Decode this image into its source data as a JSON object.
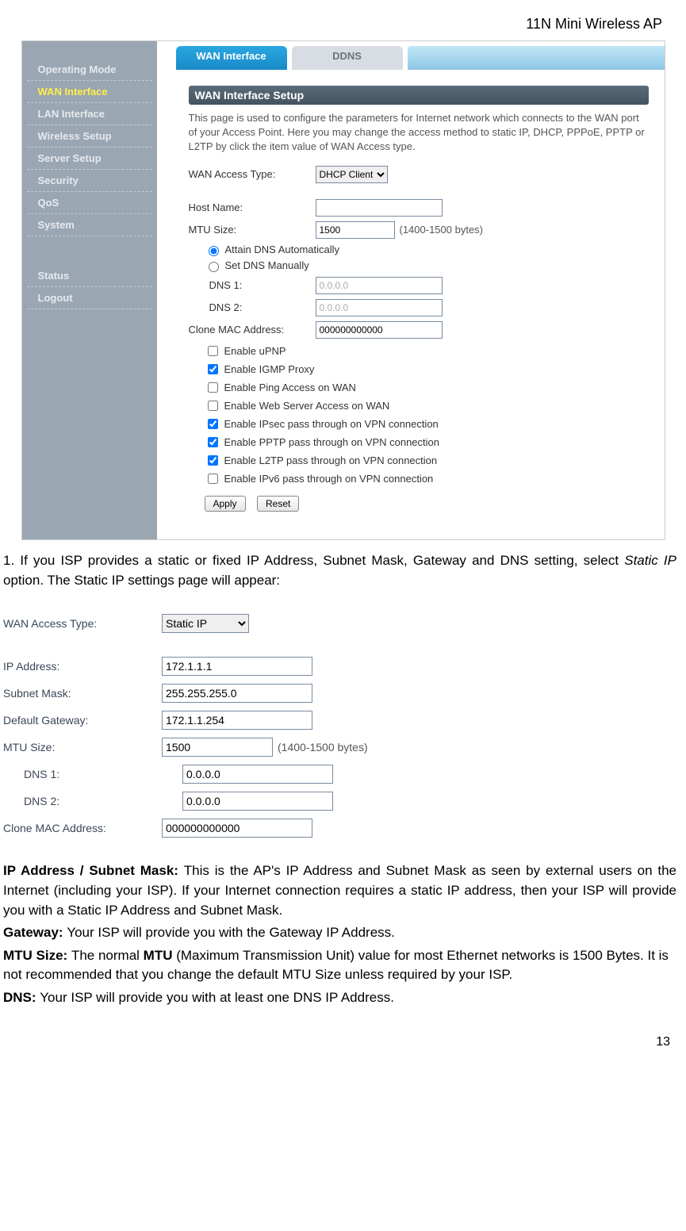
{
  "header": "11N Mini Wireless AP",
  "page_number": "13",
  "sidebar": {
    "items": [
      {
        "label": "Operating Mode",
        "active": false
      },
      {
        "label": "WAN Interface",
        "active": true
      },
      {
        "label": "LAN Interface",
        "active": false
      },
      {
        "label": "Wireless Setup",
        "active": false
      },
      {
        "label": "Server Setup",
        "active": false
      },
      {
        "label": "Security",
        "active": false
      },
      {
        "label": "QoS",
        "active": false
      },
      {
        "label": "System",
        "active": false
      }
    ],
    "lower": [
      {
        "label": "Status"
      },
      {
        "label": "Logout"
      }
    ]
  },
  "tabs": {
    "active": "WAN Interface",
    "inactive": "DDNS"
  },
  "panel": {
    "title": "WAN Interface Setup",
    "desc": "This page is used to configure the parameters for Internet network which connects to the WAN port of your Access Point. Here you may change the access method to static IP, DHCP, PPPoE, PPTP or L2TP by click the item value of WAN Access type.",
    "wan_access_label": "WAN Access Type:",
    "wan_access_value": "DHCP Client",
    "host_label": "Host Name:",
    "host_value": "",
    "mtu_label": "MTU Size:",
    "mtu_value": "1500",
    "mtu_hint": "(1400-1500 bytes)",
    "radio_auto": "Attain DNS Automatically",
    "radio_manual": "Set DNS Manually",
    "dns1_label": "DNS 1:",
    "dns1_value": "0.0.0.0",
    "dns2_label": "DNS 2:",
    "dns2_value": "0.0.0.0",
    "mac_label": "Clone MAC Address:",
    "mac_value": "000000000000",
    "checks": [
      {
        "label": "Enable uPNP",
        "checked": false
      },
      {
        "label": "Enable IGMP Proxy",
        "checked": true
      },
      {
        "label": "Enable Ping Access on WAN",
        "checked": false
      },
      {
        "label": "Enable Web Server Access on WAN",
        "checked": false
      },
      {
        "label": "Enable IPsec pass through on VPN connection",
        "checked": true
      },
      {
        "label": "Enable PPTP pass through on VPN connection",
        "checked": true
      },
      {
        "label": "Enable L2TP pass through on VPN connection",
        "checked": true
      },
      {
        "label": "Enable IPv6 pass through on VPN connection",
        "checked": false
      }
    ],
    "apply": "Apply",
    "reset": "Reset"
  },
  "text1_a": "1. If you ISP provides a static or fixed IP Address, Subnet Mask, Gateway and DNS setting, select ",
  "text1_i": "Static IP",
  "text1_b": " option. The Static IP settings page will appear:",
  "shot2": {
    "wan_label": "WAN Access Type:",
    "wan_value": "Static IP",
    "ip_label": "IP Address:",
    "ip_value": "172.1.1.1",
    "mask_label": "Subnet Mask:",
    "mask_value": "255.255.255.0",
    "gw_label": "Default Gateway:",
    "gw_value": "172.1.1.254",
    "mtu_label": "MTU Size:",
    "mtu_value": "1500",
    "mtu_hint": "(1400-1500 bytes)",
    "dns1_label": "DNS 1:",
    "dns1_value": "0.0.0.0",
    "dns2_label": "DNS 2:",
    "dns2_value": "0.0.0.0",
    "mac_label": "Clone MAC Address:",
    "mac_value": "000000000000"
  },
  "para": {
    "p1_b": "IP Address / Subnet Mask: ",
    "p1": "This is the AP's IP Address and Subnet Mask as seen by external users on the Internet (including your ISP). If your Internet connection requires a static IP address, then your ISP will provide you with a Static IP Address and Subnet Mask.",
    "p2_b": "Gateway: ",
    "p2": "Your ISP will provide you with the Gateway IP Address.",
    "p3_b": "MTU Size: ",
    "p3a": "The normal ",
    "p3_b2": "MTU",
    "p3b": " (Maximum Transmission Unit) value for most Ethernet networks is 1500 Bytes. It is not recommended that you change the default MTU Size unless required by your ISP.",
    "p4_b": "DNS: ",
    "p4": "Your ISP will provide you with at least one DNS IP Address."
  }
}
